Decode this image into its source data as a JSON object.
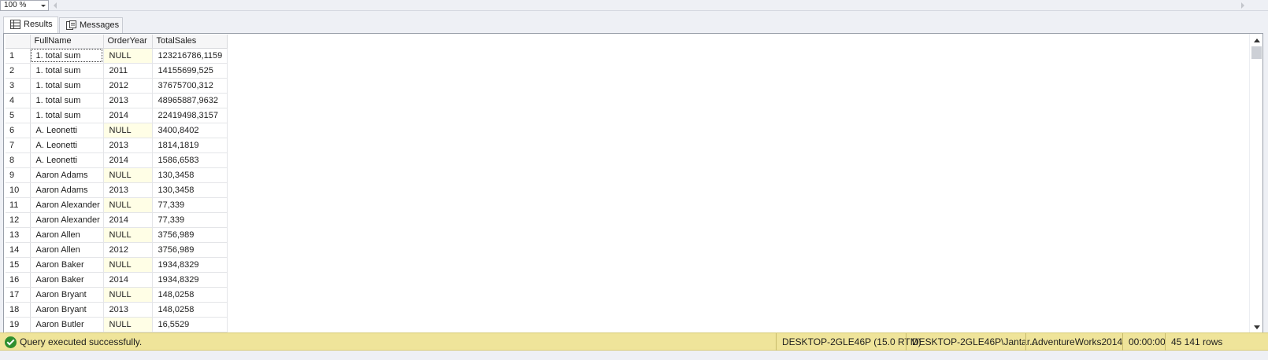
{
  "zoom": {
    "value": "100 %"
  },
  "tabs": [
    {
      "label": "Results",
      "icon": "grid-icon"
    },
    {
      "label": "Messages",
      "icon": "messages-icon"
    }
  ],
  "grid": {
    "columns": [
      "FullName",
      "OrderYear",
      "TotalSales"
    ],
    "rows": [
      [
        "1",
        "1. total sum",
        "NULL",
        "123216786,1159"
      ],
      [
        "2",
        "1. total sum",
        "2011",
        "14155699,525"
      ],
      [
        "3",
        "1. total sum",
        "2012",
        "37675700,312"
      ],
      [
        "4",
        "1. total sum",
        "2013",
        "48965887,9632"
      ],
      [
        "5",
        "1. total sum",
        "2014",
        "22419498,3157"
      ],
      [
        "6",
        "A. Leonetti",
        "NULL",
        "3400,8402"
      ],
      [
        "7",
        "A. Leonetti",
        "2013",
        "1814,1819"
      ],
      [
        "8",
        "A. Leonetti",
        "2014",
        "1586,6583"
      ],
      [
        "9",
        "Aaron Adams",
        "NULL",
        "130,3458"
      ],
      [
        "10",
        "Aaron Adams",
        "2013",
        "130,3458"
      ],
      [
        "11",
        "Aaron Alexander",
        "NULL",
        "77,339"
      ],
      [
        "12",
        "Aaron Alexander",
        "2014",
        "77,339"
      ],
      [
        "13",
        "Aaron Allen",
        "NULL",
        "3756,989"
      ],
      [
        "14",
        "Aaron Allen",
        "2012",
        "3756,989"
      ],
      [
        "15",
        "Aaron Baker",
        "NULL",
        "1934,8329"
      ],
      [
        "16",
        "Aaron Baker",
        "2014",
        "1934,8329"
      ],
      [
        "17",
        "Aaron Bryant",
        "NULL",
        "148,0258"
      ],
      [
        "18",
        "Aaron Bryant",
        "2013",
        "148,0258"
      ],
      [
        "19",
        "Aaron Butler",
        "NULL",
        "16,5529"
      ]
    ]
  },
  "status": {
    "message": "Query executed successfully.",
    "server": "DESKTOP-2GLE46P (15.0 RTM)",
    "user": "DESKTOP-2GLE46P\\Jantar...",
    "database": "AdventureWorks2014",
    "elapsed": "00:00:00",
    "rows": "45 141 rows"
  },
  "colors": {
    "null_cell": "#fffee6",
    "status_bar": "#efe49a",
    "ok_icon": "#2f8f2f"
  }
}
